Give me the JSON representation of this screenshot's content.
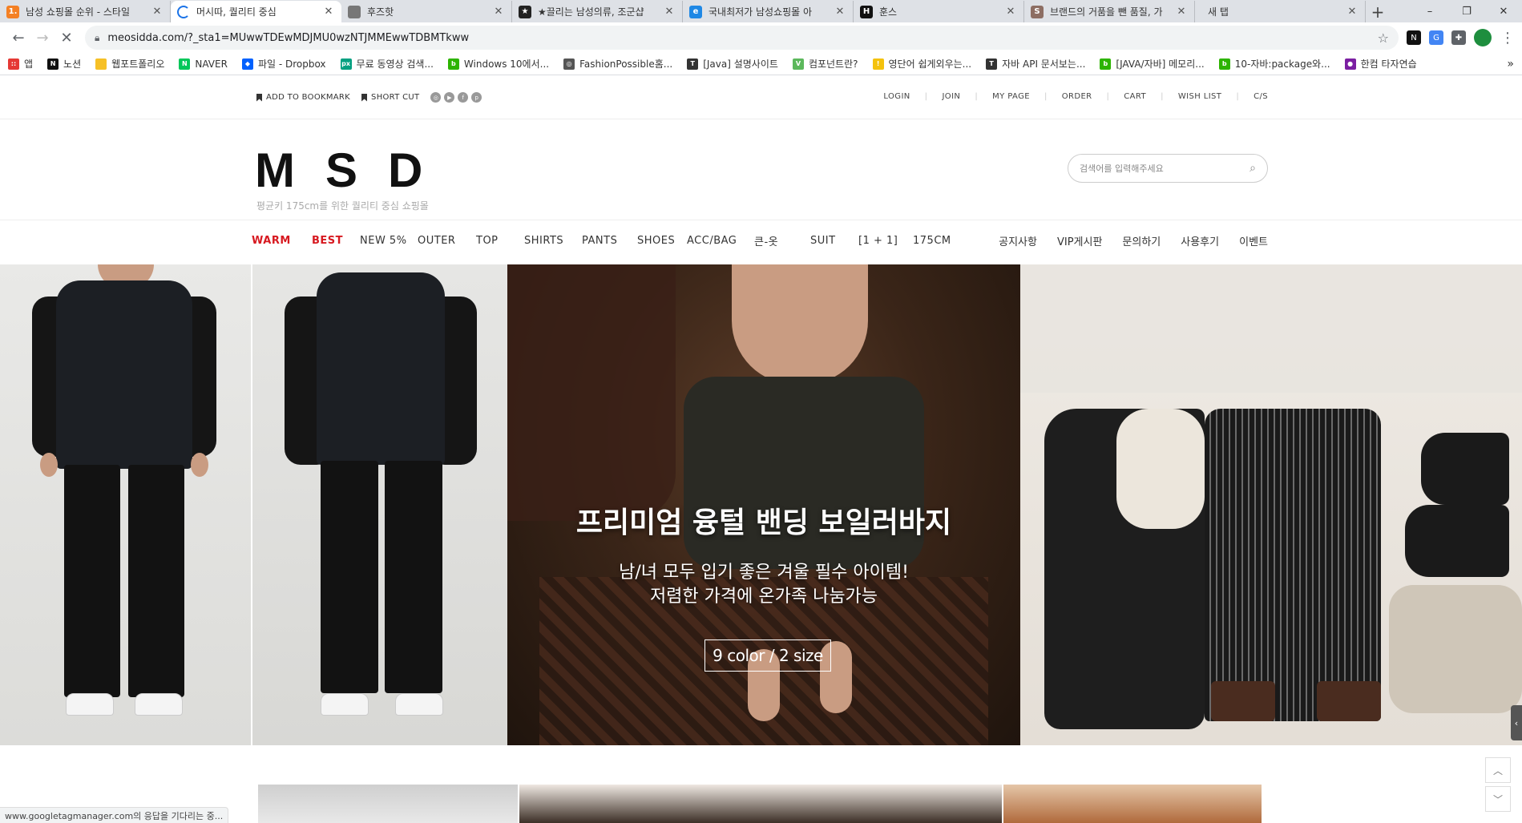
{
  "browser": {
    "tabs": [
      {
        "title": "남성 쇼핑몰 순위 - 스타일",
        "favicon": "1.",
        "fav_color": "#f48024",
        "active": false
      },
      {
        "title": "머시따, 퀄리티 중심",
        "favicon": "",
        "fav_color": "#1a73e8",
        "active": true
      },
      {
        "title": "후즈핫",
        "favicon": "",
        "fav_color": "#777777",
        "active": false
      },
      {
        "title": "★끌리는 남성의류, 조군샵",
        "favicon": "★",
        "fav_color": "#222222",
        "active": false
      },
      {
        "title": "국내최저가 남성쇼핑몰 아",
        "favicon": "e",
        "fav_color": "#1e88e5",
        "active": false
      },
      {
        "title": "훈스",
        "favicon": "H",
        "fav_color": "#111111",
        "active": false
      },
      {
        "title": "브랜드의 거품을 뺀 품질, 가",
        "favicon": "S",
        "fav_color": "#8d6e63",
        "active": false
      },
      {
        "title": "새 탭",
        "favicon": "",
        "fav_color": "#ffffff",
        "active": false
      }
    ],
    "new_tab_symbol": "+",
    "window_controls": {
      "minimize": "–",
      "restore": "❐",
      "close": "✕"
    },
    "url": "meosidda.com/?_sta1=MUwwTDEwMDJMU0wzNTJMMEwwTDBMTkww",
    "bookmarks": [
      {
        "label": "앱",
        "color": "#e53935",
        "icon": "::"
      },
      {
        "label": "노션",
        "color": "#111111",
        "icon": "N"
      },
      {
        "label": "웹포트폴리오",
        "color": "#f6c026",
        "icon": ""
      },
      {
        "label": "NAVER",
        "color": "#03c75a",
        "icon": "N"
      },
      {
        "label": "파일 - Dropbox",
        "color": "#0061fe",
        "icon": "◆"
      },
      {
        "label": "무료 동영상 검색...",
        "color": "#05a081",
        "icon": "px"
      },
      {
        "label": "Windows 10에서...",
        "color": "#2db400",
        "icon": "b"
      },
      {
        "label": "FashionPossible홈...",
        "color": "#555555",
        "icon": "◎"
      },
      {
        "label": "[Java] 설명사이트",
        "color": "#333333",
        "icon": "T"
      },
      {
        "label": "컴포넌트란?",
        "color": "#5cb85c",
        "icon": "V"
      },
      {
        "label": "영단어 쉽게외우는...",
        "color": "#f4c20d",
        "icon": "!"
      },
      {
        "label": "자바 API 문서보는...",
        "color": "#333333",
        "icon": "T"
      },
      {
        "label": "[JAVA/자바] 메모리...",
        "color": "#2db400",
        "icon": "b"
      },
      {
        "label": "10-자바:package와...",
        "color": "#2db400",
        "icon": "b"
      },
      {
        "label": "한컴 타자연습",
        "color": "#7b1fa2",
        "icon": "●"
      }
    ],
    "bookmarks_more": "»",
    "status_text": "www.googletagmanager.com의 응답을 기다리는 중..."
  },
  "site": {
    "topbar_left": {
      "bookmark": "ADD TO BOOKMARK",
      "shortcut": "SHORT CUT",
      "social": [
        "◎",
        "▶",
        "f",
        "p"
      ]
    },
    "topbar_right": [
      "LOGIN",
      "JOIN",
      "MY PAGE",
      "ORDER",
      "CART",
      "WISH LIST",
      "C/S"
    ],
    "logo": "MSD",
    "logo_sub": "평균키 175cm를 위한 퀄리티 중심 쇼핑몰",
    "search_placeholder": "검색어를 입력해주세요",
    "nav": [
      {
        "label": "WARM",
        "highlight": true,
        "width": 75
      },
      {
        "label": "BEST",
        "highlight": true,
        "width": 60
      },
      {
        "label": "NEW 5%",
        "highlight": false,
        "width": 72
      },
      {
        "label": "OUTER",
        "highlight": false,
        "width": 73
      },
      {
        "label": "TOP",
        "highlight": false,
        "width": 60
      },
      {
        "label": "SHIRTS",
        "highlight": false,
        "width": 72
      },
      {
        "label": "PANTS",
        "highlight": false,
        "width": 69
      },
      {
        "label": "SHOES",
        "highlight": false,
        "width": 62
      },
      {
        "label": "ACC/BAG",
        "highlight": false,
        "width": 84
      },
      {
        "label": "큰-옷",
        "highlight": false,
        "width": 70
      },
      {
        "label": "SUIT",
        "highlight": false,
        "width": 60
      },
      {
        "label": "[1 + 1]",
        "highlight": false,
        "width": 68
      },
      {
        "label": "175CM",
        "highlight": false,
        "width": 60
      }
    ],
    "nav_right": [
      "공지사항",
      "VIP게시판",
      "문의하기",
      "사용후기",
      "이벤트"
    ],
    "hero": {
      "title": "프리미엄 융털 밴딩 보일러바지",
      "sub1": "남/녀 모두 입기 좋은 겨울 필수 아이템!",
      "sub2": "저렴한 가격에 온가족 나눔가능",
      "badge": "9 color / 2 size"
    }
  }
}
